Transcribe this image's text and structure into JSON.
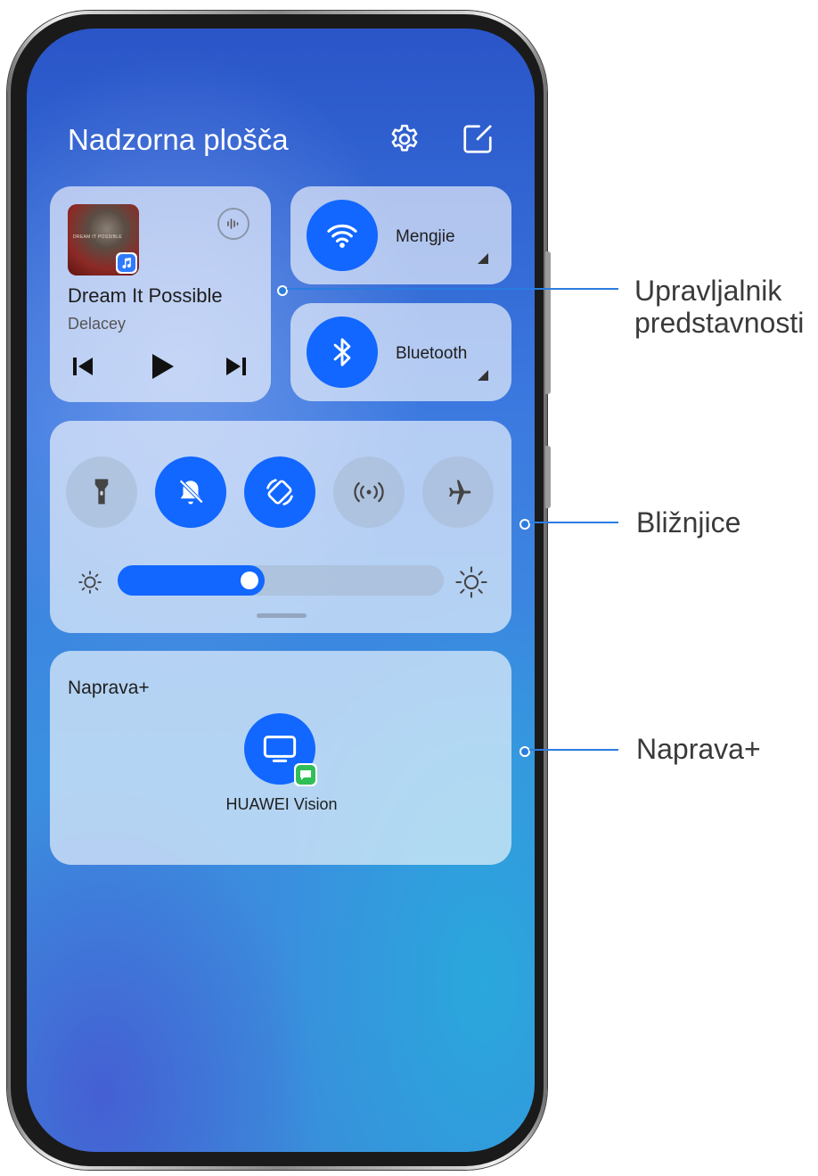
{
  "control_panel": {
    "title": "Nadzorna plošča",
    "settings_icon": "gear-icon",
    "edit_icon": "edit-icon"
  },
  "media": {
    "album_art_text": "DREAM IT POSSIBLE",
    "song_title": "Dream It Possible",
    "artist": "Delacey",
    "controls": [
      "previous-icon",
      "play-icon",
      "next-icon"
    ],
    "audio_output_icon": "audio-output-icon"
  },
  "wifi": {
    "label": "Mengjie",
    "active": true
  },
  "bluetooth": {
    "label": "Bluetooth",
    "active": true
  },
  "shortcuts": [
    {
      "name": "flashlight",
      "active": false
    },
    {
      "name": "mute",
      "active": true
    },
    {
      "name": "auto-rotate",
      "active": true
    },
    {
      "name": "hotspot",
      "active": false
    },
    {
      "name": "airplane-mode",
      "active": false
    }
  ],
  "brightness": {
    "level": 0.45
  },
  "device_plus": {
    "heading": "Naprava+",
    "device_name": "HUAWEI Vision"
  },
  "callouts": {
    "media": "Upravljalnik\npredstavnosti",
    "shortcuts": "Bližnjice",
    "device": "Naprava+"
  },
  "colors": {
    "accent": "#1167ff",
    "callout_line": "#2a7de0"
  }
}
